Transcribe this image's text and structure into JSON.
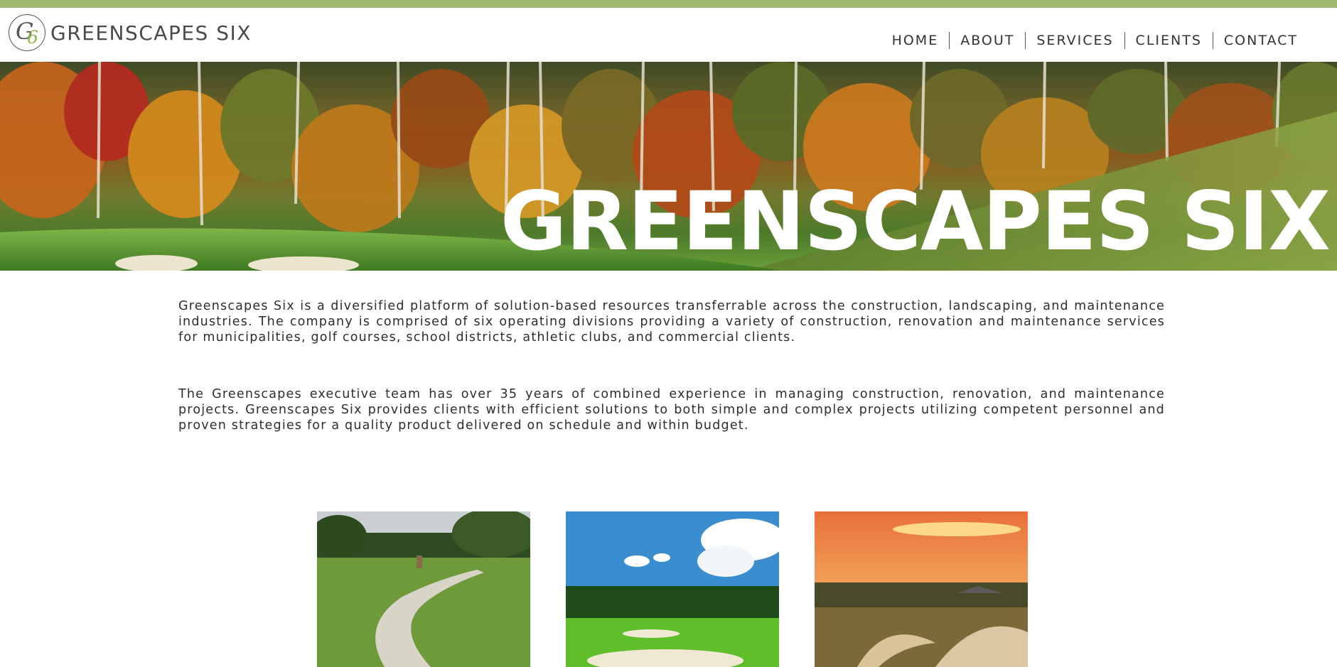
{
  "header": {
    "logo_mark_letter": "G",
    "logo_mark_number": "6",
    "logo_text": "GREENSCAPES SIX"
  },
  "nav": {
    "items": [
      {
        "label": "HOME"
      },
      {
        "label": "ABOUT"
      },
      {
        "label": "SERVICES"
      },
      {
        "label": "CLIENTS"
      },
      {
        "label": "CONTACT"
      }
    ]
  },
  "hero": {
    "title": "GREENSCAPES SIX"
  },
  "intro": {
    "paragraph_1": "Greenscapes Six is a diversified platform of solution-based resources transferrable across the construction, landscaping, and maintenance industries. The company is comprised of six operating divisions providing a variety of construction, renovation and maintenance services for municipalities, golf courses, school districts, athletic clubs, and commercial clients.",
    "paragraph_2": "The Greenscapes executive team has over 35 years of combined experience in managing construction, renovation, and maintenance projects. Greenscapes Six provides clients with efficient solutions to both simple and complex projects utilizing competent personnel and proven strategies for a quality product delivered on schedule and within budget."
  },
  "colors": {
    "accent_bar": "#9dba6e",
    "logo_green": "#8ab44a",
    "text": "#2e2e2e"
  }
}
